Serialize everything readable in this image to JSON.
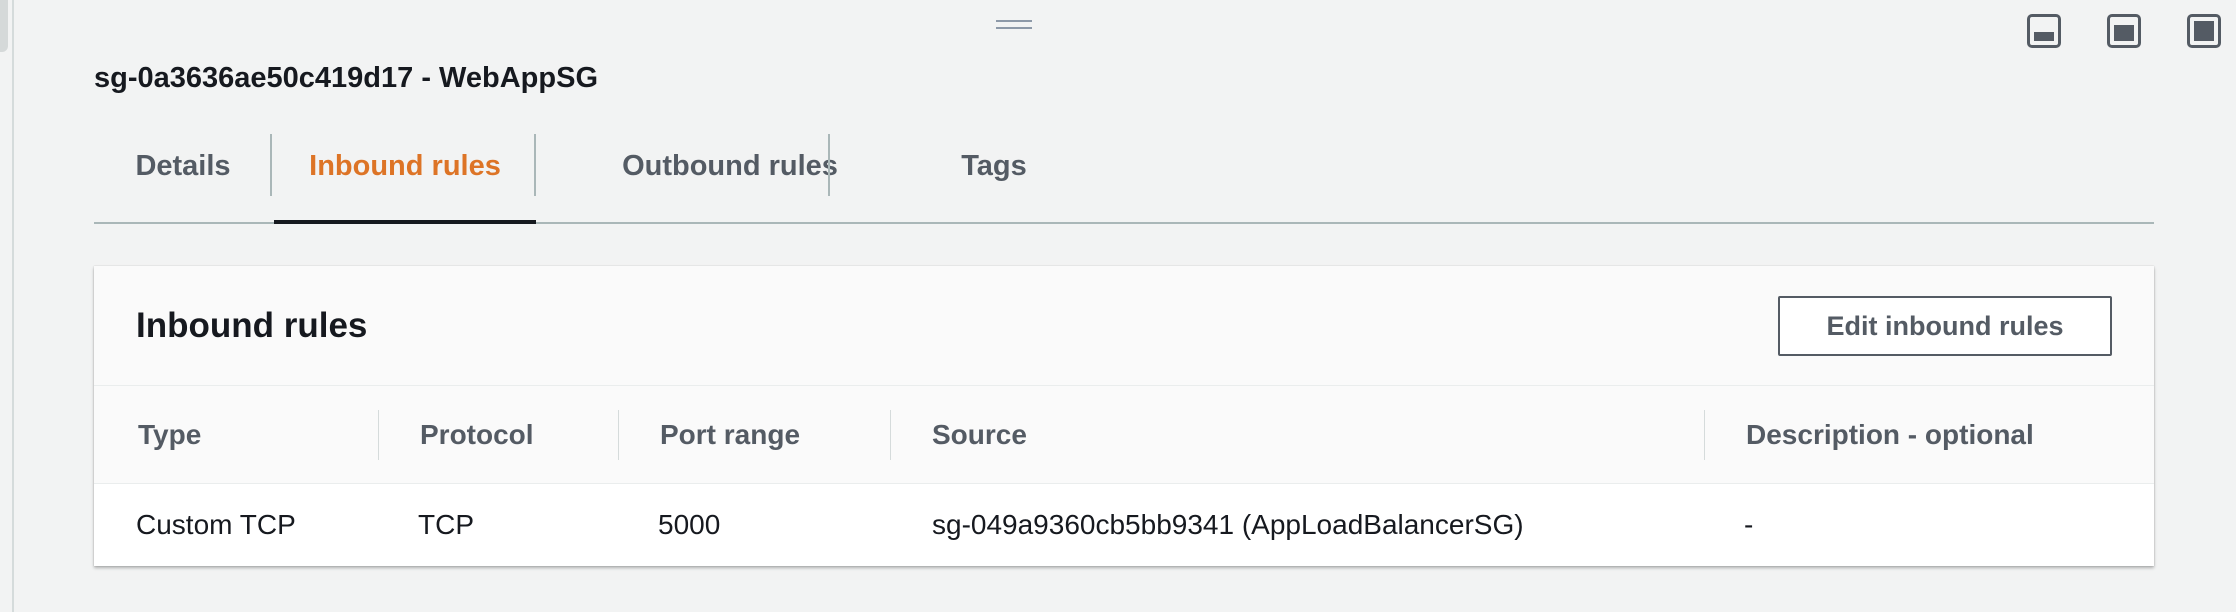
{
  "security_group": {
    "title": "sg-0a3636ae50c419d17 - WebAppSG"
  },
  "tabs": [
    {
      "label": "Details",
      "active": false
    },
    {
      "label": "Inbound rules",
      "active": true
    },
    {
      "label": "Outbound rules",
      "active": false
    },
    {
      "label": "Tags",
      "active": false
    }
  ],
  "panel": {
    "title": "Inbound rules",
    "edit_button_label": "Edit inbound rules"
  },
  "table": {
    "columns": [
      "Type",
      "Protocol",
      "Port range",
      "Source",
      "Description - optional"
    ],
    "rows": [
      [
        "Custom TCP",
        "TCP",
        "5000",
        "sg-049a9360cb5bb9341 (AppLoadBalancerSG)",
        "-"
      ]
    ]
  },
  "layout_buttons": [
    {
      "icon": "panel-bottom-small-icon"
    },
    {
      "icon": "panel-bottom-medium-icon"
    },
    {
      "icon": "panel-full-icon"
    }
  ],
  "colors": {
    "active_tab": "#dd7426",
    "background": "#f2f3f3",
    "text": "#16191f",
    "muted_text": "#545b64"
  }
}
